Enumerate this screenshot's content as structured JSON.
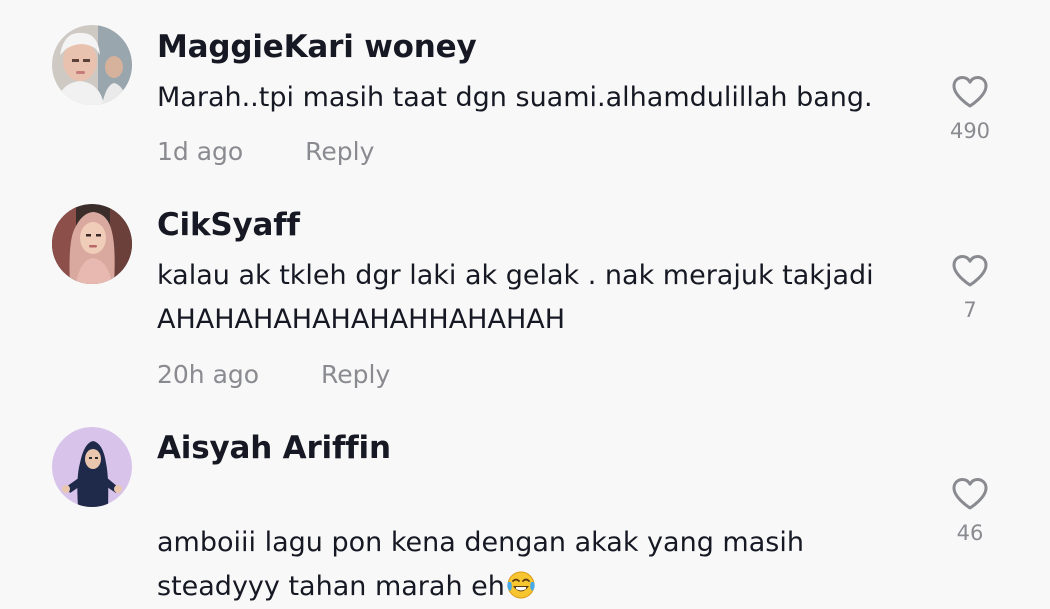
{
  "colors": {
    "background": "#f8f8f8",
    "username": "#161823",
    "text": "#161823",
    "meta": "#8a8b91"
  },
  "comments": [
    {
      "username": "MaggieKari woney",
      "text": "Marah..tpi masih taat dgn suami.alhamdulillah bang.",
      "time": "1d ago",
      "reply": "Reply",
      "likes": "490",
      "avatar_icon": "avatar-photo-icon"
    },
    {
      "username": "CikSyaff",
      "text": "kalau ak tkleh dgr laki ak gelak . nak merajuk takjadi\nAHAHAHAHAHAHAHHAHAHAH",
      "time": "20h ago",
      "reply": "Reply",
      "likes": "7",
      "avatar_icon": "avatar-photo-icon"
    },
    {
      "username": "Aisyah Ariffin",
      "text": "amboiii lagu pon kena dengan akak yang masih\nsteadyyy tahan marah eh",
      "emoji": "face-with-tears-of-joy-icon",
      "likes": "46",
      "avatar_icon": "avatar-illustration-icon"
    }
  ],
  "icons": {
    "like": "heart-outline-icon"
  }
}
